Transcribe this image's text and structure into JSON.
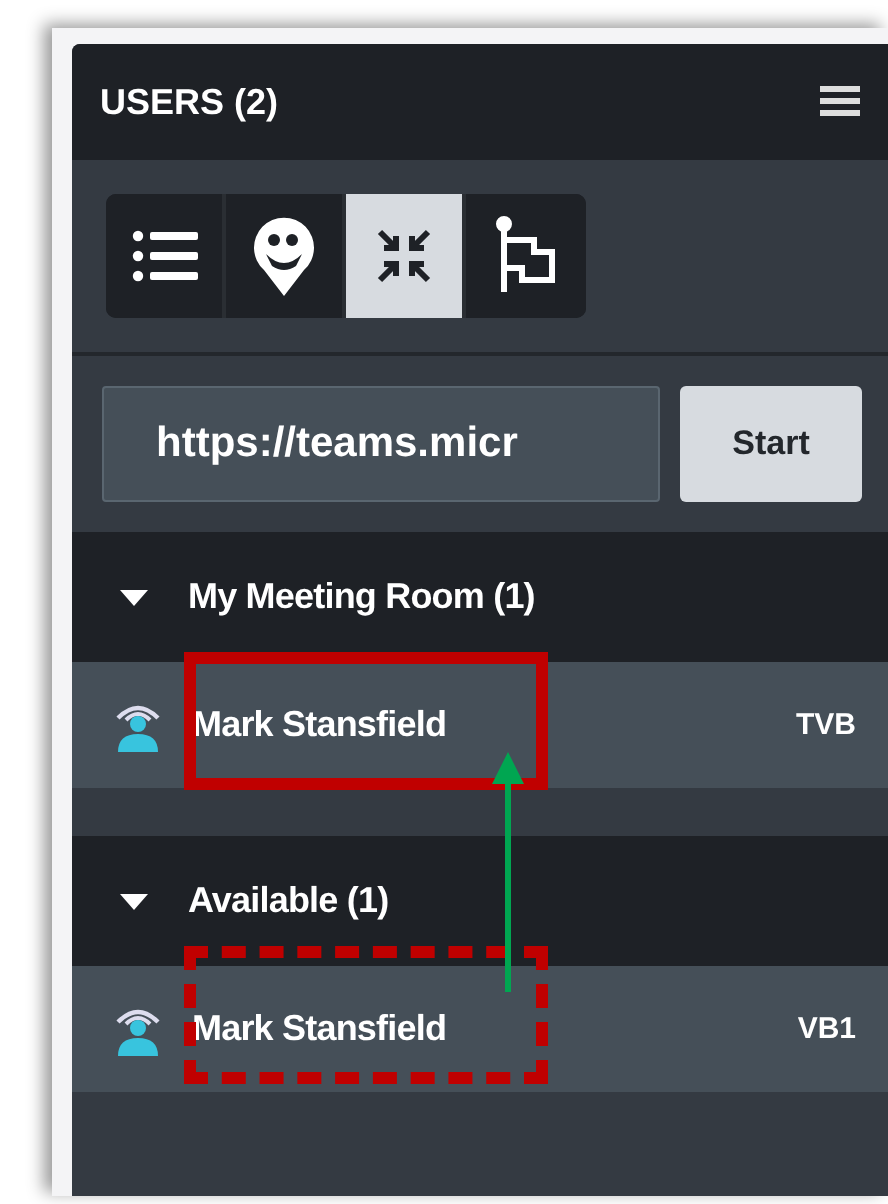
{
  "header": {
    "title": "USERS (2)"
  },
  "tools": [
    {
      "kind": "list",
      "selected": false
    },
    {
      "kind": "pin",
      "selected": false
    },
    {
      "kind": "collapse",
      "selected": true
    },
    {
      "kind": "flag",
      "selected": false
    }
  ],
  "url_field": {
    "value": "https://teams.micr"
  },
  "start_button": "Start",
  "groups": [
    {
      "title": "My Meeting Room (1)",
      "expanded": true,
      "users": [
        {
          "name": "Mark Stansfield",
          "tag": "TVB"
        }
      ]
    },
    {
      "title": "Available (1)",
      "expanded": true,
      "users": [
        {
          "name": "Mark Stansfield",
          "tag": "VB1"
        }
      ]
    }
  ],
  "annotations": [
    {
      "kind": "solid"
    },
    {
      "kind": "dashed"
    },
    {
      "kind": "arrow"
    }
  ]
}
